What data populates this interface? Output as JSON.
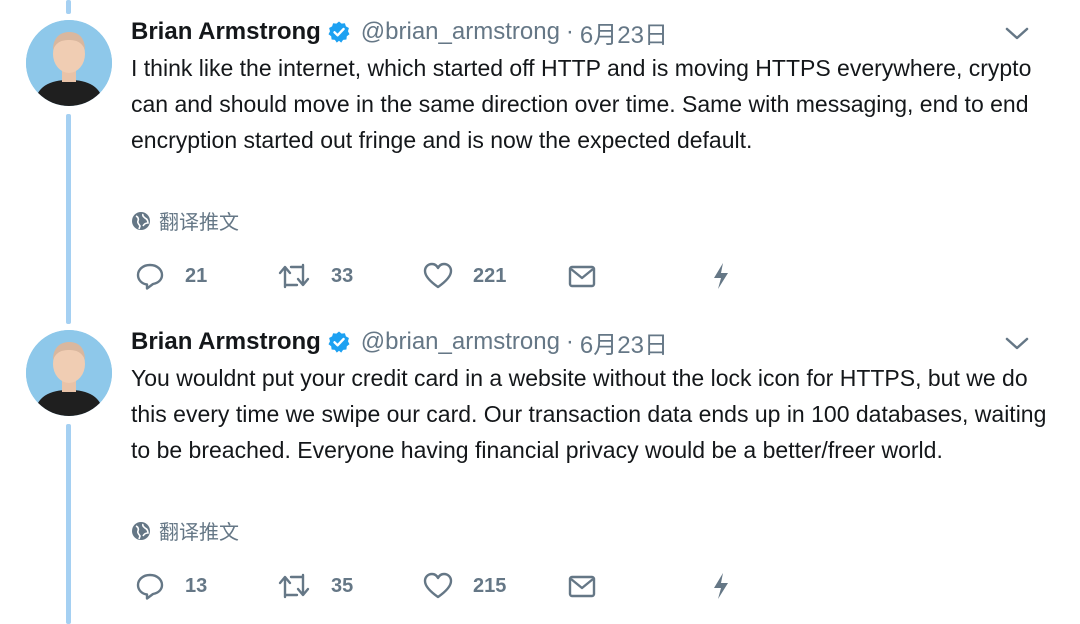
{
  "tweets": [
    {
      "author": "Brian Armstrong",
      "handle": "@brian_armstrong",
      "separator": "·",
      "date": "6月23日",
      "text": "I think like the internet, which started off HTTP and is moving HTTPS everywhere, crypto can and should move in the same direction over time. Same with messaging, end to end encryption started out fringe and is now the expected default.",
      "translate_label": "翻译推文",
      "replies": "21",
      "retweets": "33",
      "likes": "221"
    },
    {
      "author": "Brian Armstrong",
      "handle": "@brian_armstrong",
      "separator": "·",
      "date": "6月23日",
      "text": "You wouldnt put your credit card in a website without the lock icon for HTTPS, but we do this every time we swipe our card. Our transaction data ends up in 100 databases, waiting to be breached. Everyone having financial privacy would be a better/freer world.",
      "translate_label": "翻译推文",
      "replies": "13",
      "retweets": "35",
      "likes": "215"
    }
  ],
  "colors": {
    "accent": "#1da1f2",
    "thread_line": "#a5d0f2",
    "secondary_text": "#657786",
    "primary_text": "#14171a"
  },
  "icons": [
    "verified-badge-icon",
    "chevron-down-icon",
    "globe-icon",
    "reply-icon",
    "retweet-icon",
    "like-icon",
    "direct-message-icon",
    "analytics-icon"
  ]
}
